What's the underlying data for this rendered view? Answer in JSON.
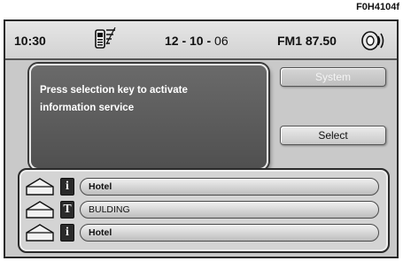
{
  "figure_ref": "F0H4104f",
  "status": {
    "time": "10:30",
    "date_main": "12 - 10 -",
    "date_year": "06",
    "radio": "FM1 87.50",
    "left_icon": "phone-signal-icon",
    "right_icon": "speaker-volume-icon"
  },
  "message": {
    "text": "Press selection key to activate\ninformation service"
  },
  "buttons": {
    "system": "System",
    "select": "Select"
  },
  "list": [
    {
      "category_icon": "house-icon",
      "type_icon": "info-icon",
      "type_glyph": "i",
      "label": "Hotel",
      "bold": true
    },
    {
      "category_icon": "house-icon",
      "type_icon": "text-icon",
      "type_glyph": "T",
      "label": "BULDING",
      "bold": false
    },
    {
      "category_icon": "house-icon",
      "type_icon": "info-icon",
      "type_glyph": "i",
      "label": "Hotel",
      "bold": true
    }
  ],
  "colors": {
    "screen_bg": "#c9c9c9",
    "message_bg": "#5e5e5e",
    "message_text": "#ffffff"
  }
}
